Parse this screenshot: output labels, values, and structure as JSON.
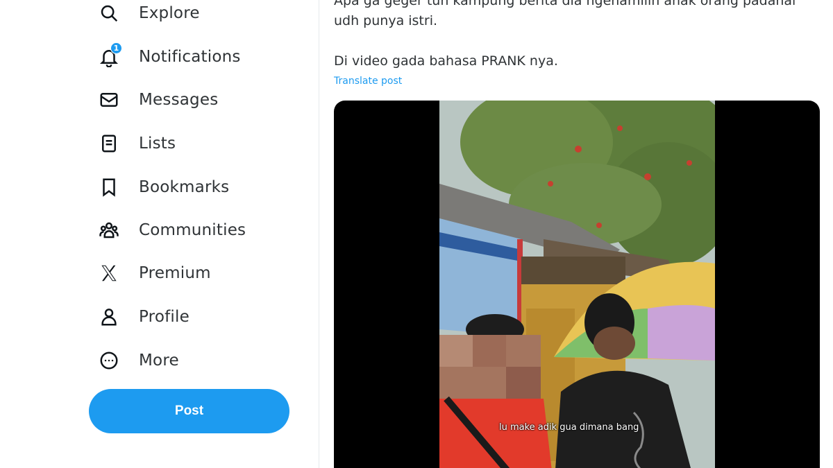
{
  "nav": {
    "items": [
      {
        "label": "Explore",
        "icon": "search-icon"
      },
      {
        "label": "Notifications",
        "icon": "bell-icon",
        "badge": "1"
      },
      {
        "label": "Messages",
        "icon": "envelope-icon"
      },
      {
        "label": "Lists",
        "icon": "list-icon"
      },
      {
        "label": "Bookmarks",
        "icon": "bookmark-icon"
      },
      {
        "label": "Communities",
        "icon": "people-icon"
      },
      {
        "label": "Premium",
        "icon": "x-logo-icon"
      },
      {
        "label": "Profile",
        "icon": "person-icon"
      },
      {
        "label": "More",
        "icon": "more-circle-icon"
      }
    ],
    "post_label": "Post"
  },
  "tweet": {
    "line_clipped": "Apa ga geger tuh kampung berita dia ngehamilin anak orang padahal",
    "line_2": "udh punya istri.",
    "line_3": "Di video gada bahasa PRANK nya.",
    "translate_label": "Translate post",
    "video_caption": "lu make adik gua dimana bang"
  },
  "colors": {
    "accent": "#1d9bf0",
    "text": "#2f3336",
    "divider": "#e6e9eb"
  }
}
